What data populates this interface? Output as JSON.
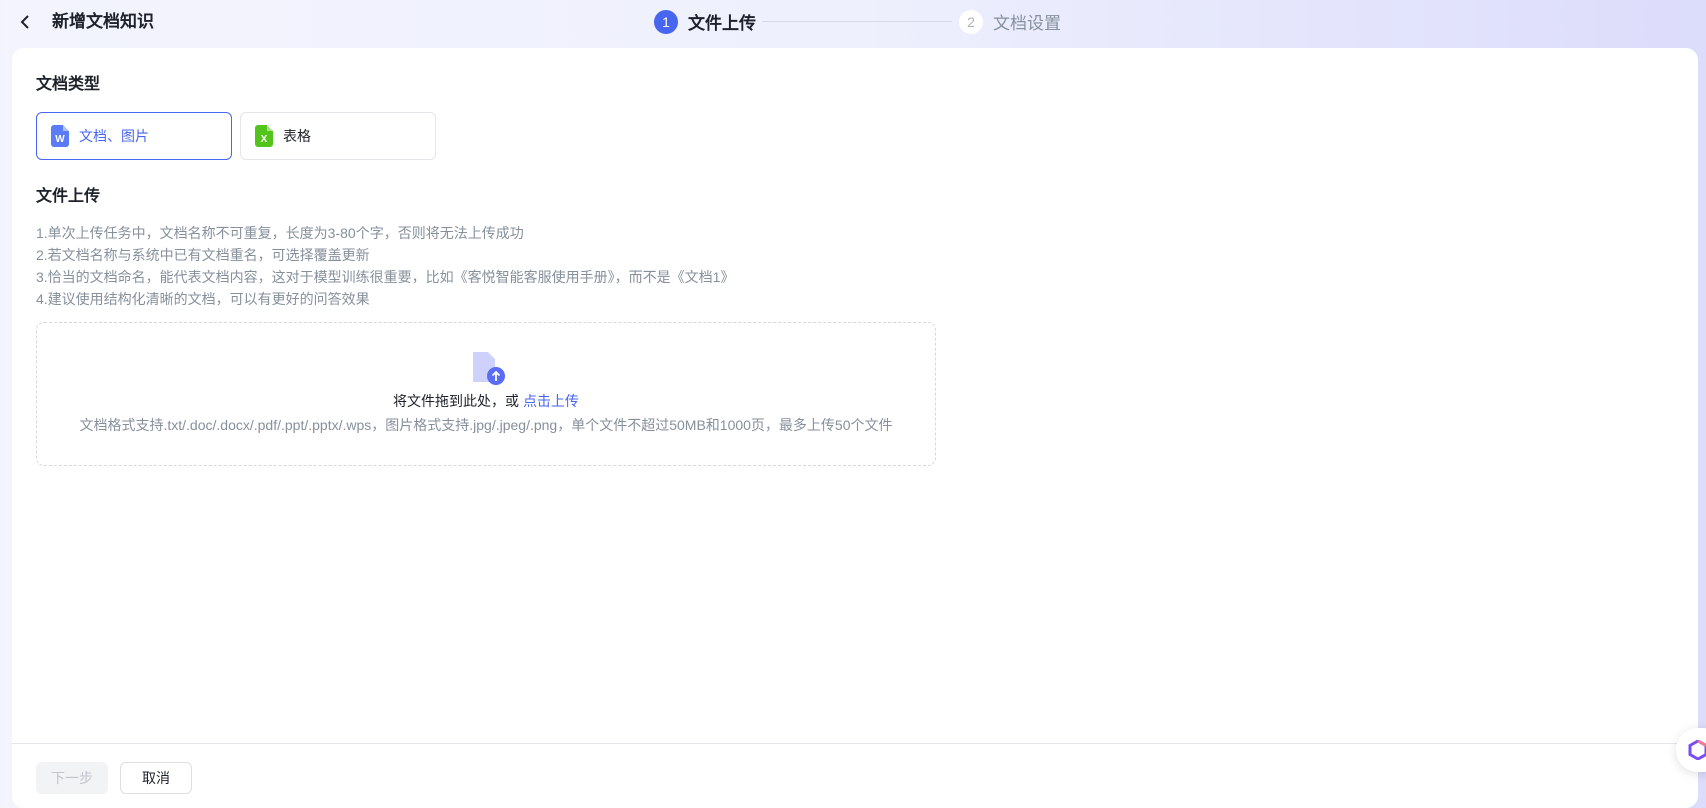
{
  "header": {
    "title": "新增文档知识",
    "steps": [
      {
        "num": "1",
        "label": "文件上传"
      },
      {
        "num": "2",
        "label": "文档设置"
      }
    ]
  },
  "doc_type": {
    "heading": "文档类型",
    "options": [
      {
        "label": "文档、图片",
        "icon_text": "W",
        "selected": true
      },
      {
        "label": "表格",
        "icon_text": "X",
        "selected": false
      }
    ]
  },
  "upload": {
    "heading": "文件上传",
    "tips": [
      "1.单次上传任务中，文档名称不可重复，长度为3-80个字，否则将无法上传成功",
      "2.若文档名称与系统中已有文档重名，可选择覆盖更新",
      "3.恰当的文档命名，能代表文档内容，这对于模型训练很重要，比如《客悦智能客服使用手册》，而不是《文档1》",
      "4.建议使用结构化清晰的文档，可以有更好的问答效果"
    ],
    "drop_text": "将文件拖到此处，或",
    "drop_link": "点击上传",
    "formats": "文档格式支持.txt/.doc/.docx/.pdf/.ppt/.pptx/.wps，图片格式支持.jpg/.jpeg/.png，单个文件不超过50MB和1000页，最多上传50个文件"
  },
  "footer": {
    "next": "下一步",
    "cancel": "取消"
  },
  "colors": {
    "accent": "#4766f0",
    "excel": "#52c41a"
  }
}
